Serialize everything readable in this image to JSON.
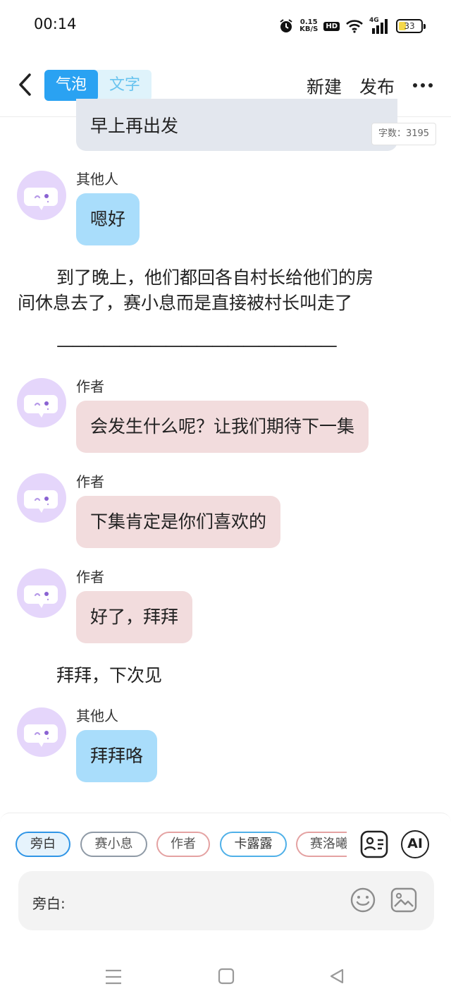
{
  "status_bar": {
    "time": "00:14",
    "speed_top": "0.15",
    "speed_unit": "KB/S",
    "hd": "HD",
    "network": "4G",
    "battery": "33",
    "battery_level": 0.33
  },
  "header": {
    "mode_bubble": "气泡",
    "mode_text": "文字",
    "new_label": "新建",
    "publish_label": "发布"
  },
  "word_count": "字数：3195",
  "messages": [
    {
      "type": "bubble",
      "sender": "",
      "text": "早上再出发"
    },
    {
      "type": "bubble",
      "sender": "其他人",
      "text": "嗯好"
    },
    {
      "type": "narration",
      "line1": "到了晚上，他们都回各自村长给他们的房",
      "line2": "间休息去了，赛小息而是直接被村长叫走了"
    },
    {
      "type": "narration",
      "text": "——————————————————"
    },
    {
      "type": "bubble",
      "sender": "作者",
      "text": "会发生什么呢？让我们期待下一集"
    },
    {
      "type": "bubble",
      "sender": "作者",
      "text": "下集肯定是你们喜欢的"
    },
    {
      "type": "bubble",
      "sender": "作者",
      "text": "好了，拜拜"
    },
    {
      "type": "narration",
      "text": "拜拜，下次见"
    },
    {
      "type": "bubble",
      "sender": "其他人",
      "text": "拜拜咯"
    }
  ],
  "characters": [
    {
      "label": "旁白",
      "color": "#2f95e6",
      "selected": true
    },
    {
      "label": "赛小息",
      "color": "#8f9aa6"
    },
    {
      "label": "作者",
      "color": "#e4a2a2"
    },
    {
      "label": "卡露露",
      "color": "#4fb0e8"
    },
    {
      "label": "赛洛曦",
      "color": "#e4a2a2"
    }
  ],
  "input": {
    "label": "旁白:",
    "value": "",
    "placeholder": ""
  },
  "icons": [
    "back-chevron-icon",
    "more-icon",
    "character-card-icon",
    "ai-icon",
    "emoji-icon",
    "image-icon",
    "menu-icon",
    "home-icon",
    "back-triangle-icon"
  ]
}
